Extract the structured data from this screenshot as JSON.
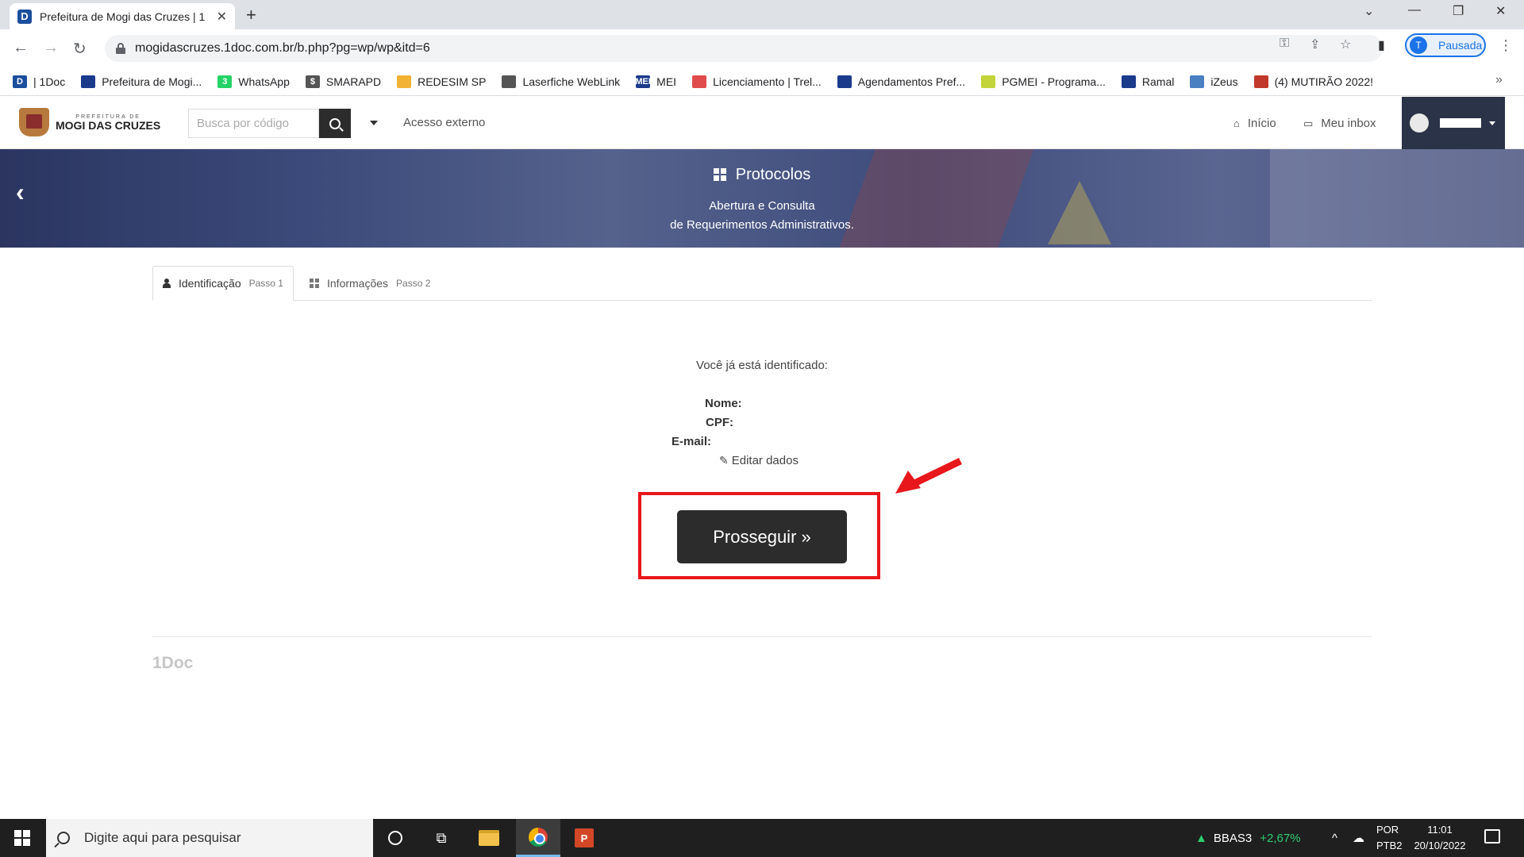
{
  "browser": {
    "tab_title": "Prefeitura de Mogi das Cruzes | 1",
    "tab_favicon": "D",
    "url": "mogidascruzes.1doc.com.br/b.php?pg=wp/wp&itd=6",
    "profile_initial": "T",
    "profile_label": "Pausada",
    "bookmarks": [
      {
        "label": "| 1Doc",
        "icon": "1doc-icon",
        "color": "#1b4f9c",
        "glyph": "D"
      },
      {
        "label": "Prefeitura de Mogi...",
        "icon": "flag-icon",
        "color": "#1b3a8c",
        "glyph": ""
      },
      {
        "label": "WhatsApp",
        "icon": "whatsapp-icon",
        "color": "#25d366",
        "glyph": "3"
      },
      {
        "label": "SMARAPD",
        "icon": "dollar-icon",
        "color": "#555555",
        "glyph": "$"
      },
      {
        "label": "REDESIM SP",
        "icon": "redesim-icon",
        "color": "#f2b233",
        "glyph": ""
      },
      {
        "label": "Laserfiche WebLink",
        "icon": "laserfiche-icon",
        "color": "#555555",
        "glyph": ""
      },
      {
        "label": "MEI",
        "icon": "mei-icon",
        "color": "#1b3a8c",
        "glyph": "MEI"
      },
      {
        "label": "Licenciamento | Trel...",
        "icon": "trello-icon",
        "color": "#e04c4c",
        "glyph": ""
      },
      {
        "label": "Agendamentos Pref...",
        "icon": "flag-icon",
        "color": "#1b3a8c",
        "glyph": ""
      },
      {
        "label": "PGMEI - Programa...",
        "icon": "pgmei-icon",
        "color": "#c2d43a",
        "glyph": ""
      },
      {
        "label": "Ramal",
        "icon": "flag-icon",
        "color": "#1b3a8c",
        "glyph": ""
      },
      {
        "label": "iZeus",
        "icon": "izeus-icon",
        "color": "#4a7fc1",
        "glyph": ""
      },
      {
        "label": "(4) MUTIRÃO 2022!",
        "icon": "mutirao-icon",
        "color": "#c0392b",
        "glyph": ""
      }
    ]
  },
  "site": {
    "logo_small": "PREFEITURA DE",
    "logo_big": "MOGI DAS CRUZES",
    "search_placeholder": "Busca por código",
    "acesso_externo": "Acesso externo",
    "inicio": "Início",
    "meu_inbox": "Meu inbox"
  },
  "banner": {
    "title": "Protocolos",
    "subtitle_line1": "Abertura e Consulta",
    "subtitle_line2": "de Requerimentos Administrativos."
  },
  "steps": [
    {
      "label": "Identificação",
      "step": "Passo 1"
    },
    {
      "label": "Informações",
      "step": "Passo 2"
    }
  ],
  "content": {
    "identified_msg": "Você já está identificado:",
    "nome_label": "Nome:",
    "cpf_label": "CPF:",
    "email_label": "E-mail:",
    "edit_label": "Editar dados",
    "prosseguir_label": "Prosseguir »",
    "highlight_color": "#e8171c"
  },
  "footer": {
    "brand": "1Doc"
  },
  "taskbar": {
    "search_placeholder": "Digite aqui para pesquisar",
    "stock_symbol": "BBAS3",
    "stock_change": "+2,67%",
    "lang_line1": "POR",
    "lang_line2": "PTB2",
    "time": "11:01",
    "date": "20/10/2022"
  }
}
